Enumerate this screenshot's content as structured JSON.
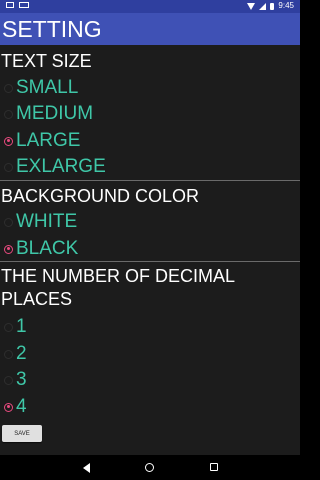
{
  "status_bar": {
    "time": "9:45",
    "icons": [
      "screenshot-icon",
      "tv-icon",
      "wifi-icon",
      "signal-icon",
      "battery-icon"
    ]
  },
  "app_bar": {
    "title": "SETTING"
  },
  "text_size": {
    "title": "TEXT SIZE",
    "options": [
      {
        "label": "SMALL",
        "checked": false
      },
      {
        "label": "MEDIUM",
        "checked": false
      },
      {
        "label": "LARGE",
        "checked": true
      },
      {
        "label": "EXLARGE",
        "checked": false
      }
    ]
  },
  "background_color": {
    "title": "BACKGROUND COLOR",
    "options": [
      {
        "label": "WHITE",
        "checked": false
      },
      {
        "label": "BLACK",
        "checked": true
      }
    ]
  },
  "decimal_places": {
    "title_line1": "THE NUMBER OF DECIMAL",
    "title_line2": "PLACES",
    "options": [
      {
        "label": "1",
        "checked": false
      },
      {
        "label": "2",
        "checked": false
      },
      {
        "label": "3",
        "checked": false
      },
      {
        "label": "4",
        "checked": true
      }
    ]
  },
  "save_button": {
    "label": "SAVE"
  },
  "colors": {
    "status_bar": "#2f3f9f",
    "app_bar": "#3f51b5",
    "background": "#1c1c1c",
    "option_text": "#3fc7a8",
    "radio_checked": "#e84a7f",
    "section_text": "#ffffff"
  },
  "nav_bar": {
    "icons": [
      "back-icon",
      "home-icon",
      "recent-apps-icon"
    ]
  }
}
